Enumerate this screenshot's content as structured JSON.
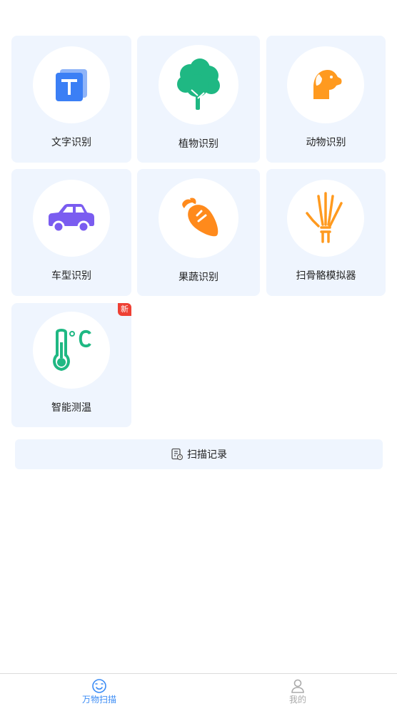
{
  "grid": {
    "items": [
      {
        "label": "文字识别",
        "icon": "text-recognition-icon",
        "color": "#3b7ff5"
      },
      {
        "label": "植物识别",
        "icon": "tree-icon",
        "color": "#1fb883"
      },
      {
        "label": "动物识别",
        "icon": "dog-icon",
        "color": "#ff9a1f"
      },
      {
        "label": "车型识别",
        "icon": "car-icon",
        "color": "#7a5cf0"
      },
      {
        "label": "果蔬识别",
        "icon": "carrot-icon",
        "color": "#ff8a1c"
      },
      {
        "label": "扫骨骼模拟器",
        "icon": "hand-bone-icon",
        "color": "#ff9a1f"
      },
      {
        "label": "智能测温",
        "icon": "thermometer-icon",
        "color": "#1fb883",
        "badge": "新"
      }
    ]
  },
  "history": {
    "label": "扫描记录",
    "icon": "history-doc-icon"
  },
  "tabbar": {
    "tabs": [
      {
        "label": "万物扫描",
        "icon": "scan-face-icon",
        "active": true,
        "color": "#3b8cf5"
      },
      {
        "label": "我的",
        "icon": "user-icon",
        "active": false,
        "color": "#aaaaaa"
      }
    ]
  }
}
